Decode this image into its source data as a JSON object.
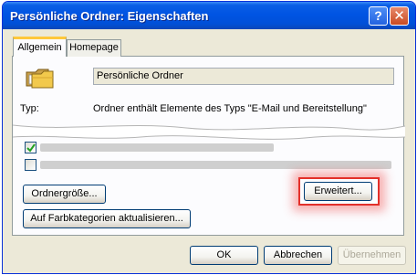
{
  "window": {
    "title": "Persönliche Ordner: Eigenschaften",
    "help_label": "?",
    "close_label": "✕"
  },
  "tabs": [
    {
      "label": "Allgemein",
      "active": true
    },
    {
      "label": "Homepage",
      "active": false
    }
  ],
  "general": {
    "folder_name": "Persönliche Ordner",
    "type_label": "Typ:",
    "type_value": "Ordner enthält Elemente des Typs \"E-Mail und Bereitstellung\""
  },
  "options": [
    {
      "checked": true
    },
    {
      "checked": false
    }
  ],
  "buttons": {
    "folder_size": "Ordnergröße...",
    "advanced": "Erweitert...",
    "update_categories": "Auf Farbkategorien aktualisieren...",
    "ok": "OK",
    "cancel": "Abbrechen",
    "apply": "Übernehmen"
  },
  "colors": {
    "titlebar": "#0054e3",
    "highlight": "#e3302a",
    "tab_accent": "#ffc83c"
  },
  "icons": [
    "folder-icon",
    "help-icon",
    "close-icon",
    "check-icon"
  ]
}
